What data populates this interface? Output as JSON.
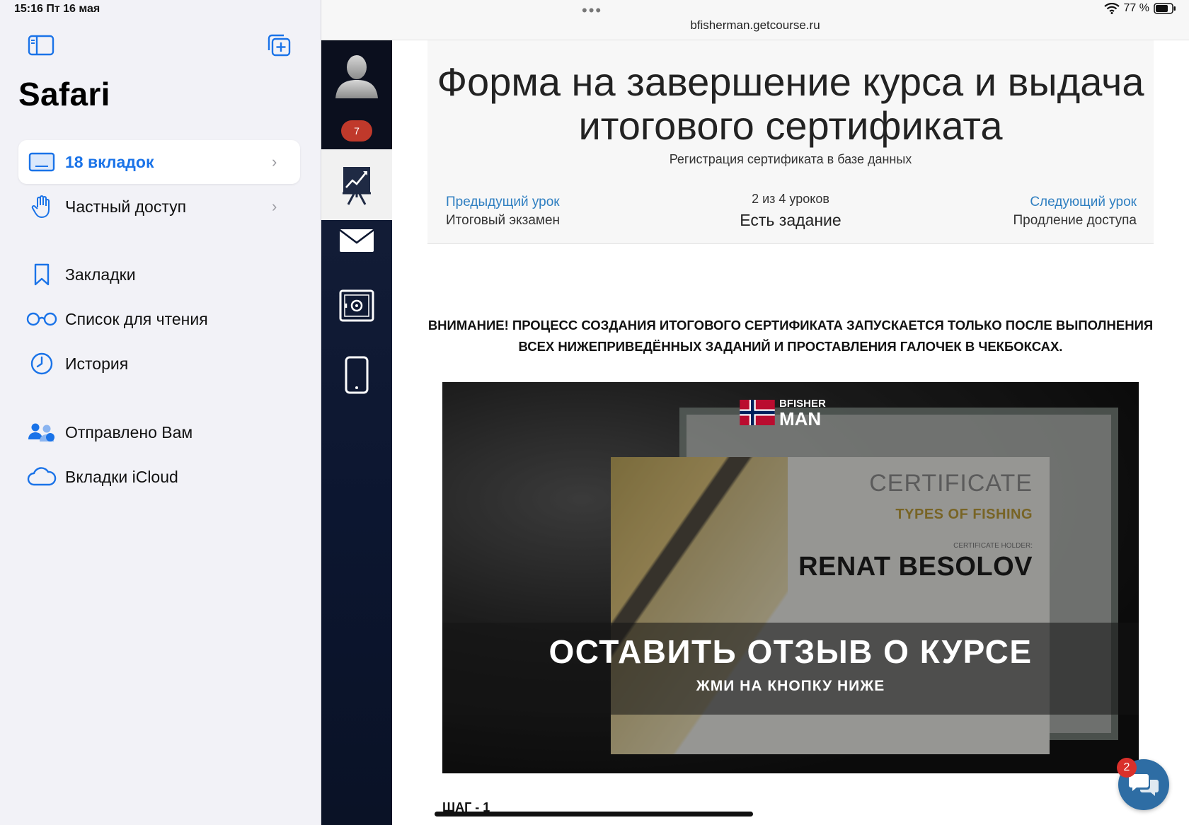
{
  "status_bar": {
    "time_date": "15:16  Пт 16 мая",
    "battery": "77 %"
  },
  "sidebar": {
    "title": "Safari",
    "items": [
      {
        "label": "18 вкладок",
        "icon": "tabs-icon",
        "chevron": true
      },
      {
        "label": "Частный доступ",
        "icon": "hand-icon",
        "chevron": true
      },
      {
        "label": "Закладки",
        "icon": "bookmark-icon"
      },
      {
        "label": "Список для чтения",
        "icon": "glasses-icon"
      },
      {
        "label": "История",
        "icon": "clock-icon"
      },
      {
        "label": "Отправлено Вам",
        "icon": "shared-people-icon"
      },
      {
        "label": "Вкладки iCloud",
        "icon": "cloud-icon"
      }
    ]
  },
  "browser": {
    "url": "bfisherman.getcourse.ru",
    "menu_dots": "•••"
  },
  "rail": {
    "notification_count": "7"
  },
  "lesson": {
    "title": "Форма на завершение курса и выдача итогового сертификата",
    "subtitle": "Регистрация сертификата в базе данных",
    "prev_link": "Предыдущий урок",
    "prev_name": "Итоговый экзамен",
    "count": "2 из 4 уроков",
    "task": "Есть задание",
    "next_link": "Следующий урок",
    "next_name": "Продление доступа"
  },
  "warning": "ВНИМАНИЕ! ПРОЦЕСС СОЗДАНИЯ ИТОГОВОГО СЕРТИФИКАТА ЗАПУСКАЕТСЯ ТОЛЬКО ПОСЛЕ ВЫПОЛНЕНИЯ ВСЕХ НИЖЕПРИВЕДЁННЫХ ЗАДАНИЙ И ПРОСТАВЛЕНИЯ ГАЛОЧЕК В ЧЕКБОКСАХ.",
  "banner": {
    "logo_top": "BFISHER",
    "logo_bottom": "MAN",
    "cert_label": "CERTIFICATE",
    "cert_course": "TYPES OF FISHING",
    "cert_holder_caption": "CERTIFICATE HOLDER:",
    "cert_name": "RENAT BESOLOV",
    "headline": "ОСТАВИТЬ ОТЗЫВ О КУРСЕ",
    "cta": "ЖМИ НА КНОПКУ НИЖЕ"
  },
  "step_label": "ШАГ - 1",
  "chat": {
    "badge": "2"
  },
  "colors": {
    "accent": "#1a73e8",
    "link": "#2f7fc1",
    "rail_bg": "#0c1630",
    "badge_red": "#c0392b",
    "chat_blue": "#2e6da4"
  }
}
